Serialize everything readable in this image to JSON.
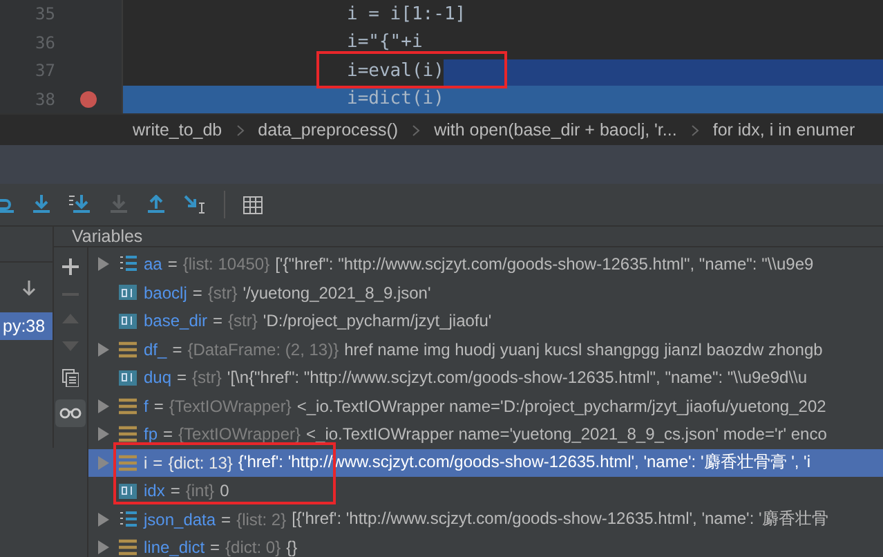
{
  "editor": {
    "lines": [
      {
        "number": "35",
        "code": "i = i[1:-1]",
        "breakpoint": false,
        "current": false,
        "selected": false
      },
      {
        "number": "36",
        "code": "i=\"{\"+i",
        "breakpoint": false,
        "current": false,
        "selected": false
      },
      {
        "number": "37",
        "code": "i=eval(i)",
        "breakpoint": false,
        "current": false,
        "selected": true
      },
      {
        "number": "38",
        "code": "i=dict(i)",
        "breakpoint": true,
        "current": true,
        "selected": false
      }
    ]
  },
  "breadcrumbs": [
    "write_to_db",
    "data_preprocess()",
    "with open(base_dir + baoclj, 'r...",
    "for idx, i in enumer"
  ],
  "frames": {
    "items": [
      {
        "label": "py:38",
        "selected": true
      }
    ]
  },
  "variables": {
    "title": "Variables",
    "rows": [
      {
        "name": "aa",
        "sep": "=",
        "kind": "list",
        "expandable": true,
        "selected": false,
        "type": "{list: 10450}",
        "value": "['{\"href\": \"http://www.scjzyt.com/goods-show-12635.html\", \"name\": \"\\\\u9e9"
      },
      {
        "name": "baoclj",
        "sep": "=",
        "kind": "str",
        "expandable": false,
        "selected": false,
        "type": "{str}",
        "value": "'/yuetong_2021_8_9.json'"
      },
      {
        "name": "base_dir",
        "sep": "=",
        "kind": "str",
        "expandable": false,
        "selected": false,
        "type": "{str}",
        "value": "'D:/project_pycharm/jzyt_jiaofu'"
      },
      {
        "name": "df_",
        "sep": "=",
        "kind": "object",
        "expandable": true,
        "selected": false,
        "type": "{DataFrame: (2, 13)}",
        "value": "href name img huodj yuanj kucsl shangpgg jianzl baozdw zhongb"
      },
      {
        "name": "duq",
        "sep": "=",
        "kind": "str",
        "expandable": false,
        "selected": false,
        "type": "{str}",
        "value": "'[\\n{\"href\": \"http://www.scjzyt.com/goods-show-12635.html\", \"name\": \"\\\\u9e9d\\\\u"
      },
      {
        "name": "f",
        "sep": "=",
        "kind": "object",
        "expandable": true,
        "selected": false,
        "type": "{TextIOWrapper}",
        "value": "<_io.TextIOWrapper name='D:/project_pycharm/jzyt_jiaofu/yuetong_202"
      },
      {
        "name": "fp",
        "sep": "=",
        "kind": "object",
        "expandable": true,
        "selected": false,
        "type": "{TextIOWrapper}",
        "value": "<_io.TextIOWrapper name='yuetong_2021_8_9_cs.json' mode='r' enco"
      },
      {
        "name": "i",
        "sep": "=",
        "kind": "object",
        "expandable": true,
        "selected": true,
        "type": "{dict: 13}",
        "value": "{'href': 'http://www.scjzyt.com/goods-show-12635.html', 'name': '麝香壮骨膏   ', 'i"
      },
      {
        "name": "idx",
        "sep": "=",
        "kind": "int",
        "expandable": false,
        "selected": false,
        "type": "{int}",
        "value": "0"
      },
      {
        "name": "json_data",
        "sep": "=",
        "kind": "list",
        "expandable": true,
        "selected": false,
        "type": "{list: 2}",
        "value": "[{'href': 'http://www.scjzyt.com/goods-show-12635.html', 'name': '麝香壮骨"
      },
      {
        "name": "line_dict",
        "sep": "=",
        "kind": "object",
        "expandable": true,
        "selected": false,
        "type": "{dict: 0}",
        "value": "{}"
      }
    ]
  }
}
